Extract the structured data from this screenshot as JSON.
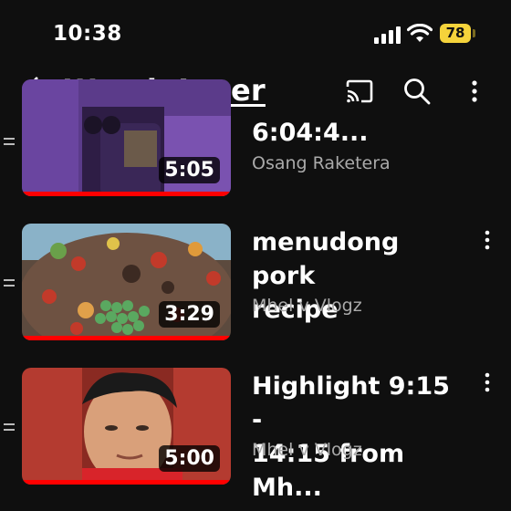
{
  "status_bar": {
    "time": "10:38",
    "battery_level": "78",
    "battery_color": "#f5d33b"
  },
  "header": {
    "title": "Watch Later",
    "icons": [
      "back-icon",
      "cast-icon",
      "search-icon",
      "more-vert-icon"
    ]
  },
  "videos": [
    {
      "title": "6:04:4...",
      "channel": "Osang Raketera",
      "duration": "5:05",
      "progress": 1.0
    },
    {
      "title_line1": "menudong pork",
      "title_line2": "recipe",
      "channel": "Mhel v Vlogz",
      "duration": "3:29",
      "progress": 1.0
    },
    {
      "title_line1": "Highlight 9:15 -",
      "title_line2": "14:15 from Mh...",
      "channel": "Mhel v Vlogz",
      "duration": "5:00",
      "progress": 1.0
    }
  ],
  "colors": {
    "background": "#0f0f0f",
    "progress": "#ff0000",
    "secondary_text": "#aaaaaa"
  }
}
